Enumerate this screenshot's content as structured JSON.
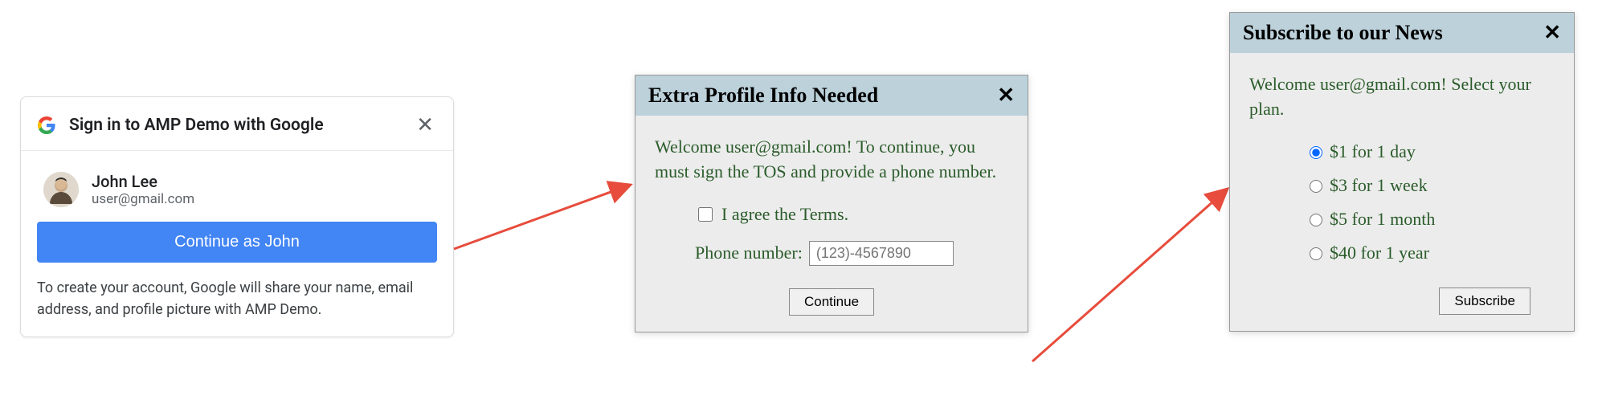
{
  "google": {
    "title": "Sign in to AMP Demo with Google",
    "user_name": "John Lee",
    "user_email": "user@gmail.com",
    "continue_label": "Continue as John",
    "disclaimer": "To create your account, Google will share your name, email address, and profile picture with AMP Demo."
  },
  "profile": {
    "title": "Extra Profile Info Needed",
    "welcome": "Welcome user@gmail.com! To continue, you must sign the TOS and provide a phone number.",
    "agree_label": "I agree the Terms.",
    "phone_label": "Phone number:",
    "phone_placeholder": "(123)-4567890",
    "continue_label": "Continue"
  },
  "subscribe": {
    "title": "Subscribe to our News",
    "welcome": "Welcome user@gmail.com! Select your plan.",
    "plans": {
      "p0": "$1 for 1 day",
      "p1": "$3 for 1 week",
      "p2": "$5 for 1 month",
      "p3": "$40 for 1 year"
    },
    "selected_index": 0,
    "subscribe_label": "Subscribe"
  }
}
